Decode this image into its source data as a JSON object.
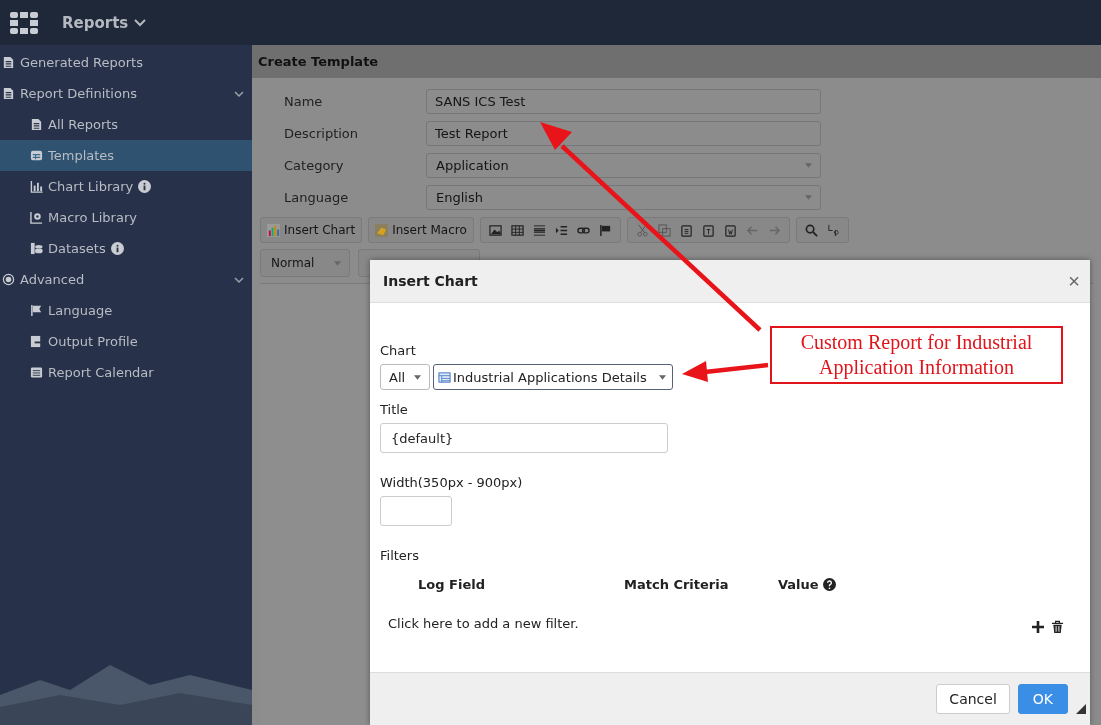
{
  "app": {
    "title": "Reports"
  },
  "sidebar": {
    "items": [
      {
        "label": "Generated Reports",
        "selected": false
      },
      {
        "label": "Report Definitions",
        "selected": false,
        "expanded": true,
        "children": [
          {
            "label": "All Reports",
            "selected": false,
            "info": false
          },
          {
            "label": "Templates",
            "selected": true,
            "info": false
          },
          {
            "label": "Chart Library",
            "selected": false,
            "info": true
          },
          {
            "label": "Macro Library",
            "selected": false,
            "info": false
          },
          {
            "label": "Datasets",
            "selected": false,
            "info": true
          }
        ]
      },
      {
        "label": "Advanced",
        "selected": false,
        "expanded": true,
        "children": [
          {
            "label": "Language",
            "selected": false,
            "info": false
          },
          {
            "label": "Output Profile",
            "selected": false,
            "info": false
          },
          {
            "label": "Report Calendar",
            "selected": false,
            "info": false
          }
        ]
      }
    ]
  },
  "create_template": {
    "title": "Create Template",
    "fields": [
      {
        "label": "Name",
        "value": "SANS ICS Test",
        "kind": "text"
      },
      {
        "label": "Description",
        "value": "Test Report",
        "kind": "text"
      },
      {
        "label": "Category",
        "value": "Application",
        "kind": "select"
      },
      {
        "label": "Language",
        "value": "English",
        "kind": "select"
      }
    ],
    "toolbar": {
      "buttons": [
        "Insert Chart",
        "Insert Macro"
      ],
      "format": "Normal"
    }
  },
  "dialog": {
    "title": "Insert Chart",
    "close": "×",
    "chart_label": "Chart",
    "chart_filter": "All",
    "chart": "Industrial Applications Details",
    "title_label": "Title",
    "title_value": "{default}",
    "width_label": "Width(350px - 900px)",
    "filters_label": "Filters",
    "columns": [
      "Log Field",
      "Match Criteria",
      "Value"
    ],
    "add_filter": "Click here to add a new filter.",
    "buttons": [
      {
        "label": "Cancel",
        "primary": false
      },
      {
        "label": "OK",
        "primary": true
      }
    ]
  },
  "annotation": {
    "lines": [
      "Custom Report for Industrial",
      "Application Information"
    ]
  }
}
